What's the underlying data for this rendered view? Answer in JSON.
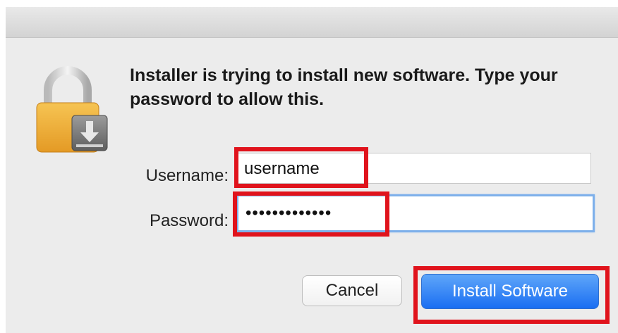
{
  "dialog": {
    "message": "Installer is trying to install new software. Type your password to allow this.",
    "icon": "padlock-installer-icon"
  },
  "form": {
    "username_label": "Username:",
    "username_value": "username",
    "password_label": "Password:",
    "password_value": "•••••••••••••"
  },
  "buttons": {
    "cancel_label": "Cancel",
    "install_label": "Install Software"
  },
  "colors": {
    "highlight": "#e0131c",
    "primary_button": "#1a6ef2",
    "focus_ring": "#7eb0ea"
  }
}
